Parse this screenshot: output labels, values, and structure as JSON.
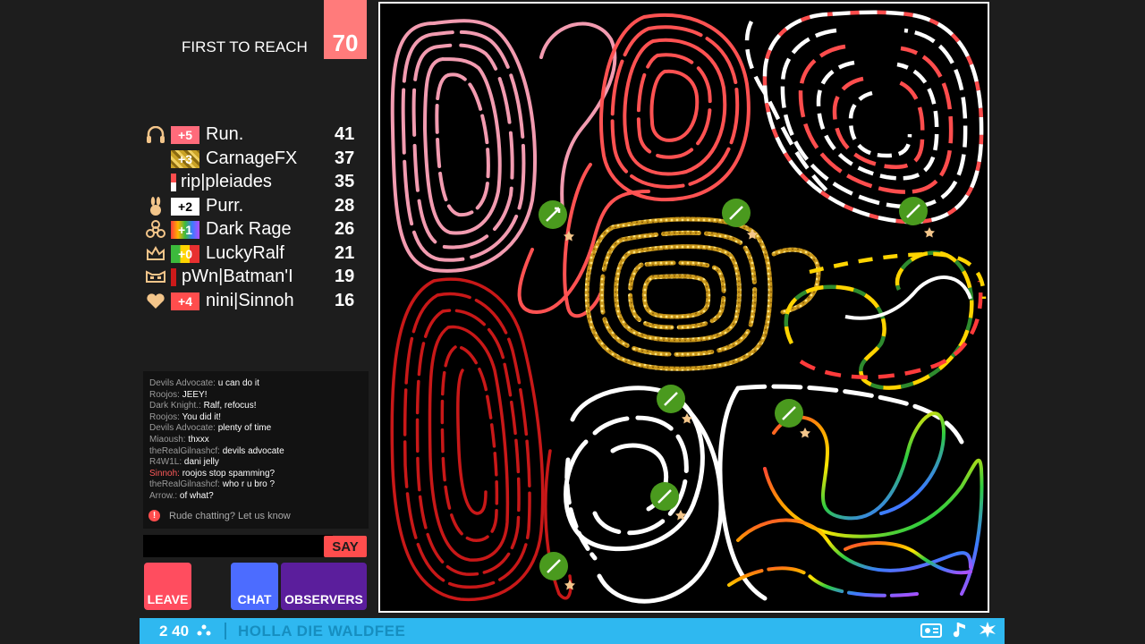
{
  "header": {
    "label": "FIRST TO REACH",
    "target": "70",
    "target_color": "#ff7b7b"
  },
  "scoreboard": [
    {
      "icon": "headphones-icon",
      "badge": "+5",
      "badge_color": "#ff6b7b",
      "name": "Run.",
      "score": "41"
    },
    {
      "icon": "",
      "badge": "+3",
      "badge_color": "#c9a227",
      "name": "CarnageFX",
      "score": "37"
    },
    {
      "icon": "",
      "badge": "",
      "badge_color": "#ff4d4d",
      "name": "rip|pleiades",
      "score": "35"
    },
    {
      "icon": "bunny-icon",
      "badge": "+2",
      "badge_color": "#ffffff",
      "name": "Purr.",
      "score": "28"
    },
    {
      "icon": "biohazard-icon",
      "badge": "+1",
      "badge_color": "#b44cff",
      "name": "Dark Rage",
      "score": "26"
    },
    {
      "icon": "crown-icon",
      "badge": "+0",
      "badge_color": "#3cba3c",
      "name": "LuckyRalf",
      "score": "21"
    },
    {
      "icon": "mask-icon",
      "badge": "",
      "badge_color": "#cc1a1a",
      "name": "pWn|Batman'I",
      "score": "19"
    },
    {
      "icon": "heart-icon",
      "badge": "+4",
      "badge_color": "#ff4d4d",
      "name": "nini|Sinnoh",
      "score": "16"
    }
  ],
  "chat": {
    "messages": [
      {
        "user": "Devils Advocate:",
        "text": "u can do it",
        "user_color": "gray"
      },
      {
        "user": "Roojos:",
        "text": "JEEY!",
        "user_color": "gray"
      },
      {
        "user": "Dark Knight.:",
        "text": "Ralf, refocus!",
        "user_color": "gray"
      },
      {
        "user": "Roojos:",
        "text": "You did it!",
        "user_color": "gray"
      },
      {
        "user": "Devils Advocate:",
        "text": "plenty of time",
        "user_color": "gray"
      },
      {
        "user": "Miaoush:",
        "text": "thxxx",
        "user_color": "gray"
      },
      {
        "user": "theRealGilnashcf:",
        "text": "devils advocate",
        "user_color": "gray"
      },
      {
        "user": "R4W1L:",
        "text": "dani jelly",
        "user_color": "gray"
      },
      {
        "user": "Sinnoh:",
        "text": "roojos stop spamming?",
        "user_color": "red"
      },
      {
        "user": "theRealGilnashcf:",
        "text": "who r u bro ?",
        "user_color": "gray"
      },
      {
        "user": "Arrow.:",
        "text": "of what?",
        "user_color": "gray"
      }
    ],
    "report_text": "Rude chatting? Let us know",
    "input_value": "",
    "say_label": "SAY"
  },
  "buttons": {
    "leave": "LEAVE",
    "chat": "CHAT",
    "observers": "OBSERVERS"
  },
  "bottom_bar": {
    "count": "2 40",
    "title": "HOLLA DIE WALDFEE",
    "bar_color": "#2fb8f0",
    "icons": [
      "radio-icon",
      "music-note-icon",
      "settings-icon"
    ]
  },
  "colors": {
    "accent_red": "#ff4d4d",
    "pink": "#f29bb0",
    "gold": "#e8b923",
    "powerup_green": "#4a9a1e"
  }
}
